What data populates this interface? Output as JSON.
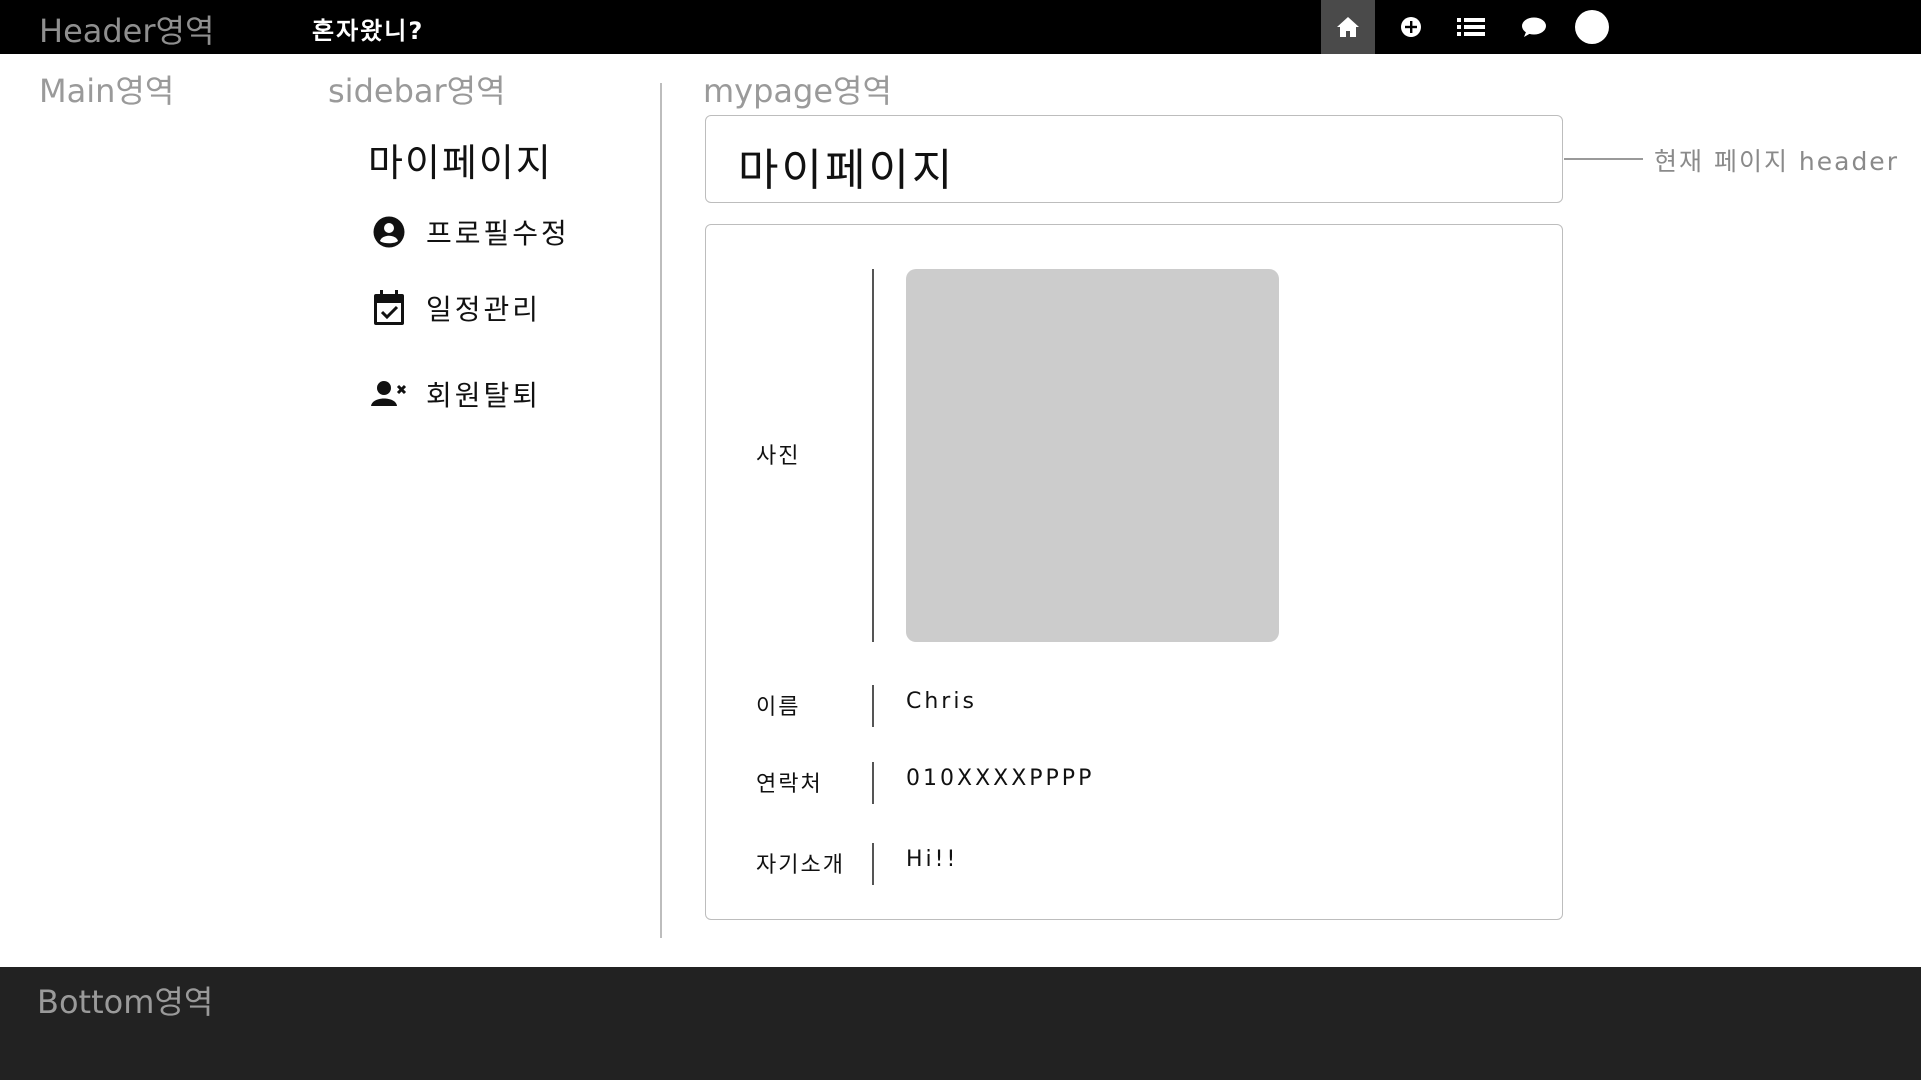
{
  "header": {
    "area_label": "Header영역",
    "brand": "혼자왔니?",
    "nav": [
      {
        "icon": "home-icon",
        "active": true
      },
      {
        "icon": "plus-circle-icon",
        "active": false
      },
      {
        "icon": "list-icon",
        "active": false
      },
      {
        "icon": "chat-bubble-icon",
        "active": false
      },
      {
        "icon": "avatar-circle-icon",
        "active": false
      }
    ]
  },
  "main": {
    "area_label": "Main영역"
  },
  "sidebar": {
    "area_label": "sidebar영역",
    "title": "마이페이지",
    "items": [
      {
        "label": "프로필수정",
        "icon": "user-circle-icon"
      },
      {
        "label": "일정관리",
        "icon": "calendar-check-icon"
      },
      {
        "label": "회원탈퇴",
        "icon": "user-remove-icon"
      }
    ]
  },
  "mypage": {
    "area_label": "mypage영역",
    "header_title": "마이페이지",
    "header_annotation": "현재 페이지 header",
    "fields": {
      "photo_label": "사진",
      "name_label": "이름",
      "name_value": "Chris",
      "contact_label": "연락처",
      "contact_value": "010XXXXPPPP",
      "intro_label": "자기소개",
      "intro_value": "Hi!!"
    }
  },
  "bottom": {
    "area_label": "Bottom영역"
  },
  "colors": {
    "topbar": "#000000",
    "active_nav": "#4a4a4a",
    "bottom": "#222222",
    "photo_placeholder": "#cccccc",
    "label_gray": "#9a9a9a"
  }
}
